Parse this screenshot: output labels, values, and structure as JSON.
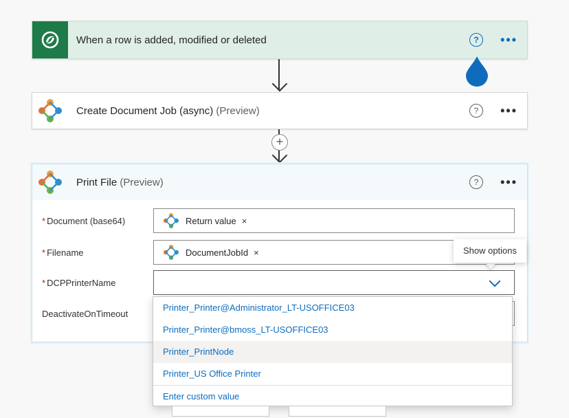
{
  "trigger": {
    "title": "When a row is added, modified or deleted",
    "help": "?",
    "more": "•••"
  },
  "step2": {
    "title": "Create Document Job (async)",
    "preview": "(Preview)",
    "help": "?",
    "more": "•••"
  },
  "step3": {
    "title": "Print File",
    "preview": "(Preview)",
    "help": "?",
    "more": "•••",
    "fields": [
      {
        "label": "Document (base64)",
        "required": "*",
        "token": "Return value",
        "token_remove": "×"
      },
      {
        "label": "Filename",
        "required": "*",
        "token": "DocumentJobId",
        "token_remove": "×"
      },
      {
        "label": "DCPPrinterName",
        "required": "*",
        "value": ""
      },
      {
        "label": "DeactivateOnTimeout",
        "required": ""
      }
    ]
  },
  "tooltip": {
    "text": "Show options"
  },
  "dropdown": {
    "options": [
      "Printer_Printer@Administrator_LT-USOFFICE03",
      "Printer_Printer@bmoss_LT-USOFFICE03",
      "Printer_PrintNode",
      "Printer_US Office Printer"
    ],
    "custom": "Enter custom value",
    "hovered_index": 2
  },
  "colors": {
    "accent": "#0f6cbd",
    "trigger_bg": "#dfeee6",
    "dataverse_green": "#1e7a48",
    "required": "#a4262c"
  },
  "plus": "+"
}
